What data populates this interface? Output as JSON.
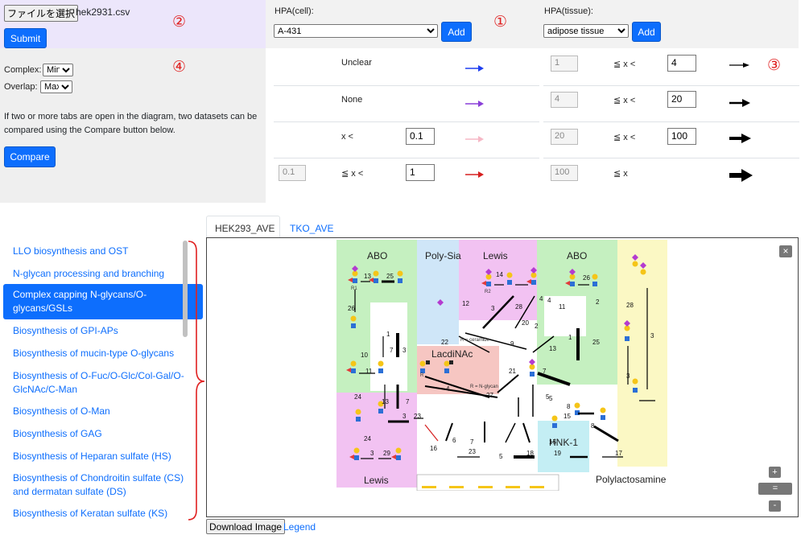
{
  "file": {
    "choose_label": "ファイルを選択",
    "filename": "hek2931.csv",
    "submit_label": "Submit"
  },
  "hpa": {
    "cell_label": "HPA(cell):",
    "cell_value": "A-431",
    "tissue_label": "HPA(tissue):",
    "tissue_value": "adipose tissue",
    "add_label": "Add"
  },
  "markers": {
    "m1": "①",
    "m2": "②",
    "m3": "③",
    "m4": "④",
    "m5": "⑤"
  },
  "compare": {
    "complex_label": "Complex:",
    "complex_value": "Min",
    "overlap_label": "Overlap:",
    "overlap_value": "Max",
    "info": "If two or more tabs are open in the diagram, two datasets can be compared using the Compare button below.",
    "button_label": "Compare"
  },
  "legend_colors": {
    "rows": [
      {
        "pre": "",
        "label": "Unclear",
        "value": "",
        "color": "#1f3ff0"
      },
      {
        "pre": "",
        "label": "None",
        "value": "",
        "color": "#8a3fd8"
      },
      {
        "pre": "",
        "label": "x <",
        "value": "0.1",
        "color": "#f6b8c6"
      },
      {
        "pre": "0.1",
        "label": "≦ x <",
        "value": "1",
        "color": "#d62020"
      }
    ]
  },
  "legend_widths": {
    "rows": [
      {
        "low": "1",
        "label": "≦ x <",
        "high": "4"
      },
      {
        "low": "4",
        "label": "≦ x <",
        "high": "20"
      },
      {
        "low": "20",
        "label": "≦ x <",
        "high": "100"
      },
      {
        "low": "100",
        "label": "≦ x",
        "high": ""
      }
    ]
  },
  "sidebar": {
    "items": [
      "LLO biosynthesis and OST",
      "N-glycan processing and branching",
      "Complex capping N-glycans/O-glycans/GSLs",
      "Biosynthesis of GPI-APs",
      "Biosynthesis of mucin-type O-glycans",
      "Biosynthesis of O-Fuc/O-Glc/Col-Gal/O-GlcNAc/C-Man",
      "Biosynthesis of O-Man",
      "Biosynthesis of GAG",
      "Biosynthesis of Heparan sulfate (HS)",
      "Biosynthesis of Chondroitin sulfate (CS) and dermatan sulfate (DS)",
      "Biosynthesis of Keratan sulfate (KS)"
    ]
  },
  "tabs": [
    "HEK293_AVE",
    "TKO_AVE"
  ],
  "diagram": {
    "regions": [
      "ABO",
      "Poly-Sia",
      "Lewis",
      "ABO",
      "LacdiNAc",
      "Lewis",
      "HNK-1",
      "Polylactosamine"
    ],
    "numbers": [
      "13",
      "25",
      "26",
      "1",
      "7",
      "3",
      "10",
      "11",
      "24",
      "13",
      "7",
      "3",
      "23",
      "22",
      "9",
      "12",
      "3",
      "28",
      "14",
      "4",
      "11",
      "2",
      "20",
      "13",
      "1",
      "21",
      "7",
      "5",
      "8",
      "15",
      "8",
      "19",
      "17",
      "15",
      "18",
      "5",
      "23",
      "16",
      "6",
      "7",
      "24",
      "3",
      "29",
      "4",
      "26",
      "2",
      "25",
      "28",
      "3",
      "3",
      "27",
      "4",
      "5"
    ],
    "small_text": [
      "R1",
      "R2",
      "R",
      "R = ceramide",
      "R = N-glycan"
    ]
  },
  "bottom": {
    "download_label": "Download Image",
    "legend_label": "Legend"
  },
  "zoom": {
    "plus": "+",
    "reset": "=",
    "minus": "-",
    "close": "×"
  }
}
